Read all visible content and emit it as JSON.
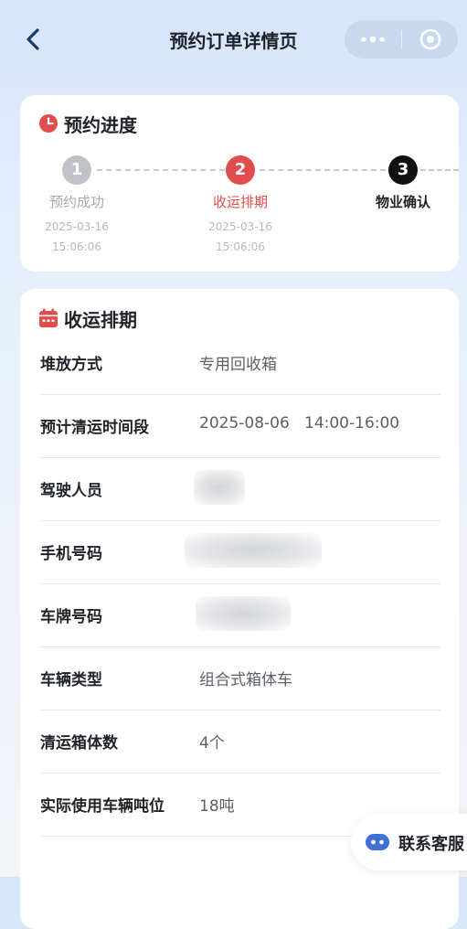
{
  "nav": {
    "title": "预约订单详情页"
  },
  "colors": {
    "accent_red": "#e14d4d",
    "step_gray": "#bfc2c7",
    "step_black": "#111111"
  },
  "progress": {
    "title": "预约进度",
    "steps": [
      {
        "number": "1",
        "label": "预约成功",
        "date": "2025-03-16",
        "time": "15:06:06",
        "state": "done"
      },
      {
        "number": "2",
        "label": "收运排期",
        "date": "2025-03-16",
        "time": "15:06:06",
        "state": "current"
      },
      {
        "number": "3",
        "label": "物业确认",
        "state": "pending"
      }
    ]
  },
  "schedule": {
    "title": "收运排期",
    "rows": [
      {
        "label": "堆放方式",
        "value": "专用回收箱"
      },
      {
        "label": "预计清运时间段",
        "value": "2025-08-06   14:00-16:00"
      },
      {
        "label": "驾驶人员",
        "value": ""
      },
      {
        "label": "手机号码",
        "value": ""
      },
      {
        "label": "车牌号码",
        "value": ""
      },
      {
        "label": "车辆类型",
        "value": "组合式箱体车"
      },
      {
        "label": "清运箱体数",
        "value": "4个"
      },
      {
        "label": "实际使用车辆吨位",
        "value": "18吨"
      }
    ]
  },
  "customer_service": {
    "label": "联系客服"
  }
}
